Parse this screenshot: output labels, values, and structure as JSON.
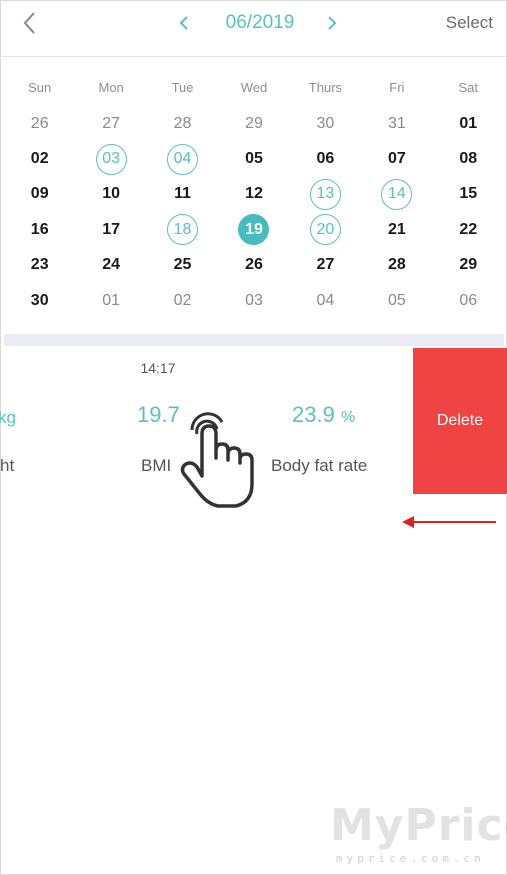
{
  "header": {
    "month": "06/2019",
    "select_label": "Select"
  },
  "calendar": {
    "weekdays": [
      "Sun",
      "Mon",
      "Tue",
      "Wed",
      "Thurs",
      "Fri",
      "Sat"
    ],
    "rows": [
      [
        {
          "d": "26",
          "s": "muted"
        },
        {
          "d": "27",
          "s": "muted"
        },
        {
          "d": "28",
          "s": "muted"
        },
        {
          "d": "29",
          "s": "muted"
        },
        {
          "d": "30",
          "s": "muted"
        },
        {
          "d": "31",
          "s": "muted"
        },
        {
          "d": "01",
          "s": "normal"
        }
      ],
      [
        {
          "d": "02",
          "s": "normal"
        },
        {
          "d": "03",
          "s": "ring"
        },
        {
          "d": "04",
          "s": "ring"
        },
        {
          "d": "05",
          "s": "normal"
        },
        {
          "d": "06",
          "s": "normal"
        },
        {
          "d": "07",
          "s": "normal"
        },
        {
          "d": "08",
          "s": "normal"
        }
      ],
      [
        {
          "d": "09",
          "s": "normal"
        },
        {
          "d": "10",
          "s": "normal"
        },
        {
          "d": "11",
          "s": "normal"
        },
        {
          "d": "12",
          "s": "normal"
        },
        {
          "d": "13",
          "s": "ring"
        },
        {
          "d": "14",
          "s": "ring"
        },
        {
          "d": "15",
          "s": "normal"
        }
      ],
      [
        {
          "d": "16",
          "s": "normal"
        },
        {
          "d": "17",
          "s": "normal"
        },
        {
          "d": "18",
          "s": "ring"
        },
        {
          "d": "19",
          "s": "selected"
        },
        {
          "d": "20",
          "s": "ring"
        },
        {
          "d": "21",
          "s": "normal"
        },
        {
          "d": "22",
          "s": "normal"
        }
      ],
      [
        {
          "d": "23",
          "s": "normal"
        },
        {
          "d": "24",
          "s": "normal"
        },
        {
          "d": "25",
          "s": "normal"
        },
        {
          "d": "26",
          "s": "normal"
        },
        {
          "d": "27",
          "s": "normal"
        },
        {
          "d": "28",
          "s": "normal"
        },
        {
          "d": "29",
          "s": "normal"
        }
      ],
      [
        {
          "d": "30",
          "s": "normal"
        },
        {
          "d": "01",
          "s": "muted"
        },
        {
          "d": "02",
          "s": "muted"
        },
        {
          "d": "03",
          "s": "muted"
        },
        {
          "d": "04",
          "s": "muted"
        },
        {
          "d": "05",
          "s": "muted"
        },
        {
          "d": "06",
          "s": "muted"
        }
      ]
    ]
  },
  "record": {
    "time": "14:17",
    "weight_unit": "kg",
    "weight_label": "ht",
    "bmi_value": "19.7",
    "bmi_label": "BMI",
    "body_fat_value": "23.9",
    "body_fat_unit": "%",
    "body_fat_label": "Body fat rate",
    "delete_label": "Delete"
  },
  "watermark": {
    "brand": "MyPrice",
    "url": "myprice.com.cn"
  },
  "colors": {
    "accent": "#5bbfc3",
    "selected_fill": "#47bcc0",
    "delete_red": "#f04444",
    "arrow_red": "#e0201c"
  },
  "icons": {
    "back": "chevron-left-icon",
    "prev": "chevron-left-icon",
    "next": "chevron-right-icon",
    "gesture": "tap-hand-icon",
    "swipe": "arrow-left-icon"
  }
}
